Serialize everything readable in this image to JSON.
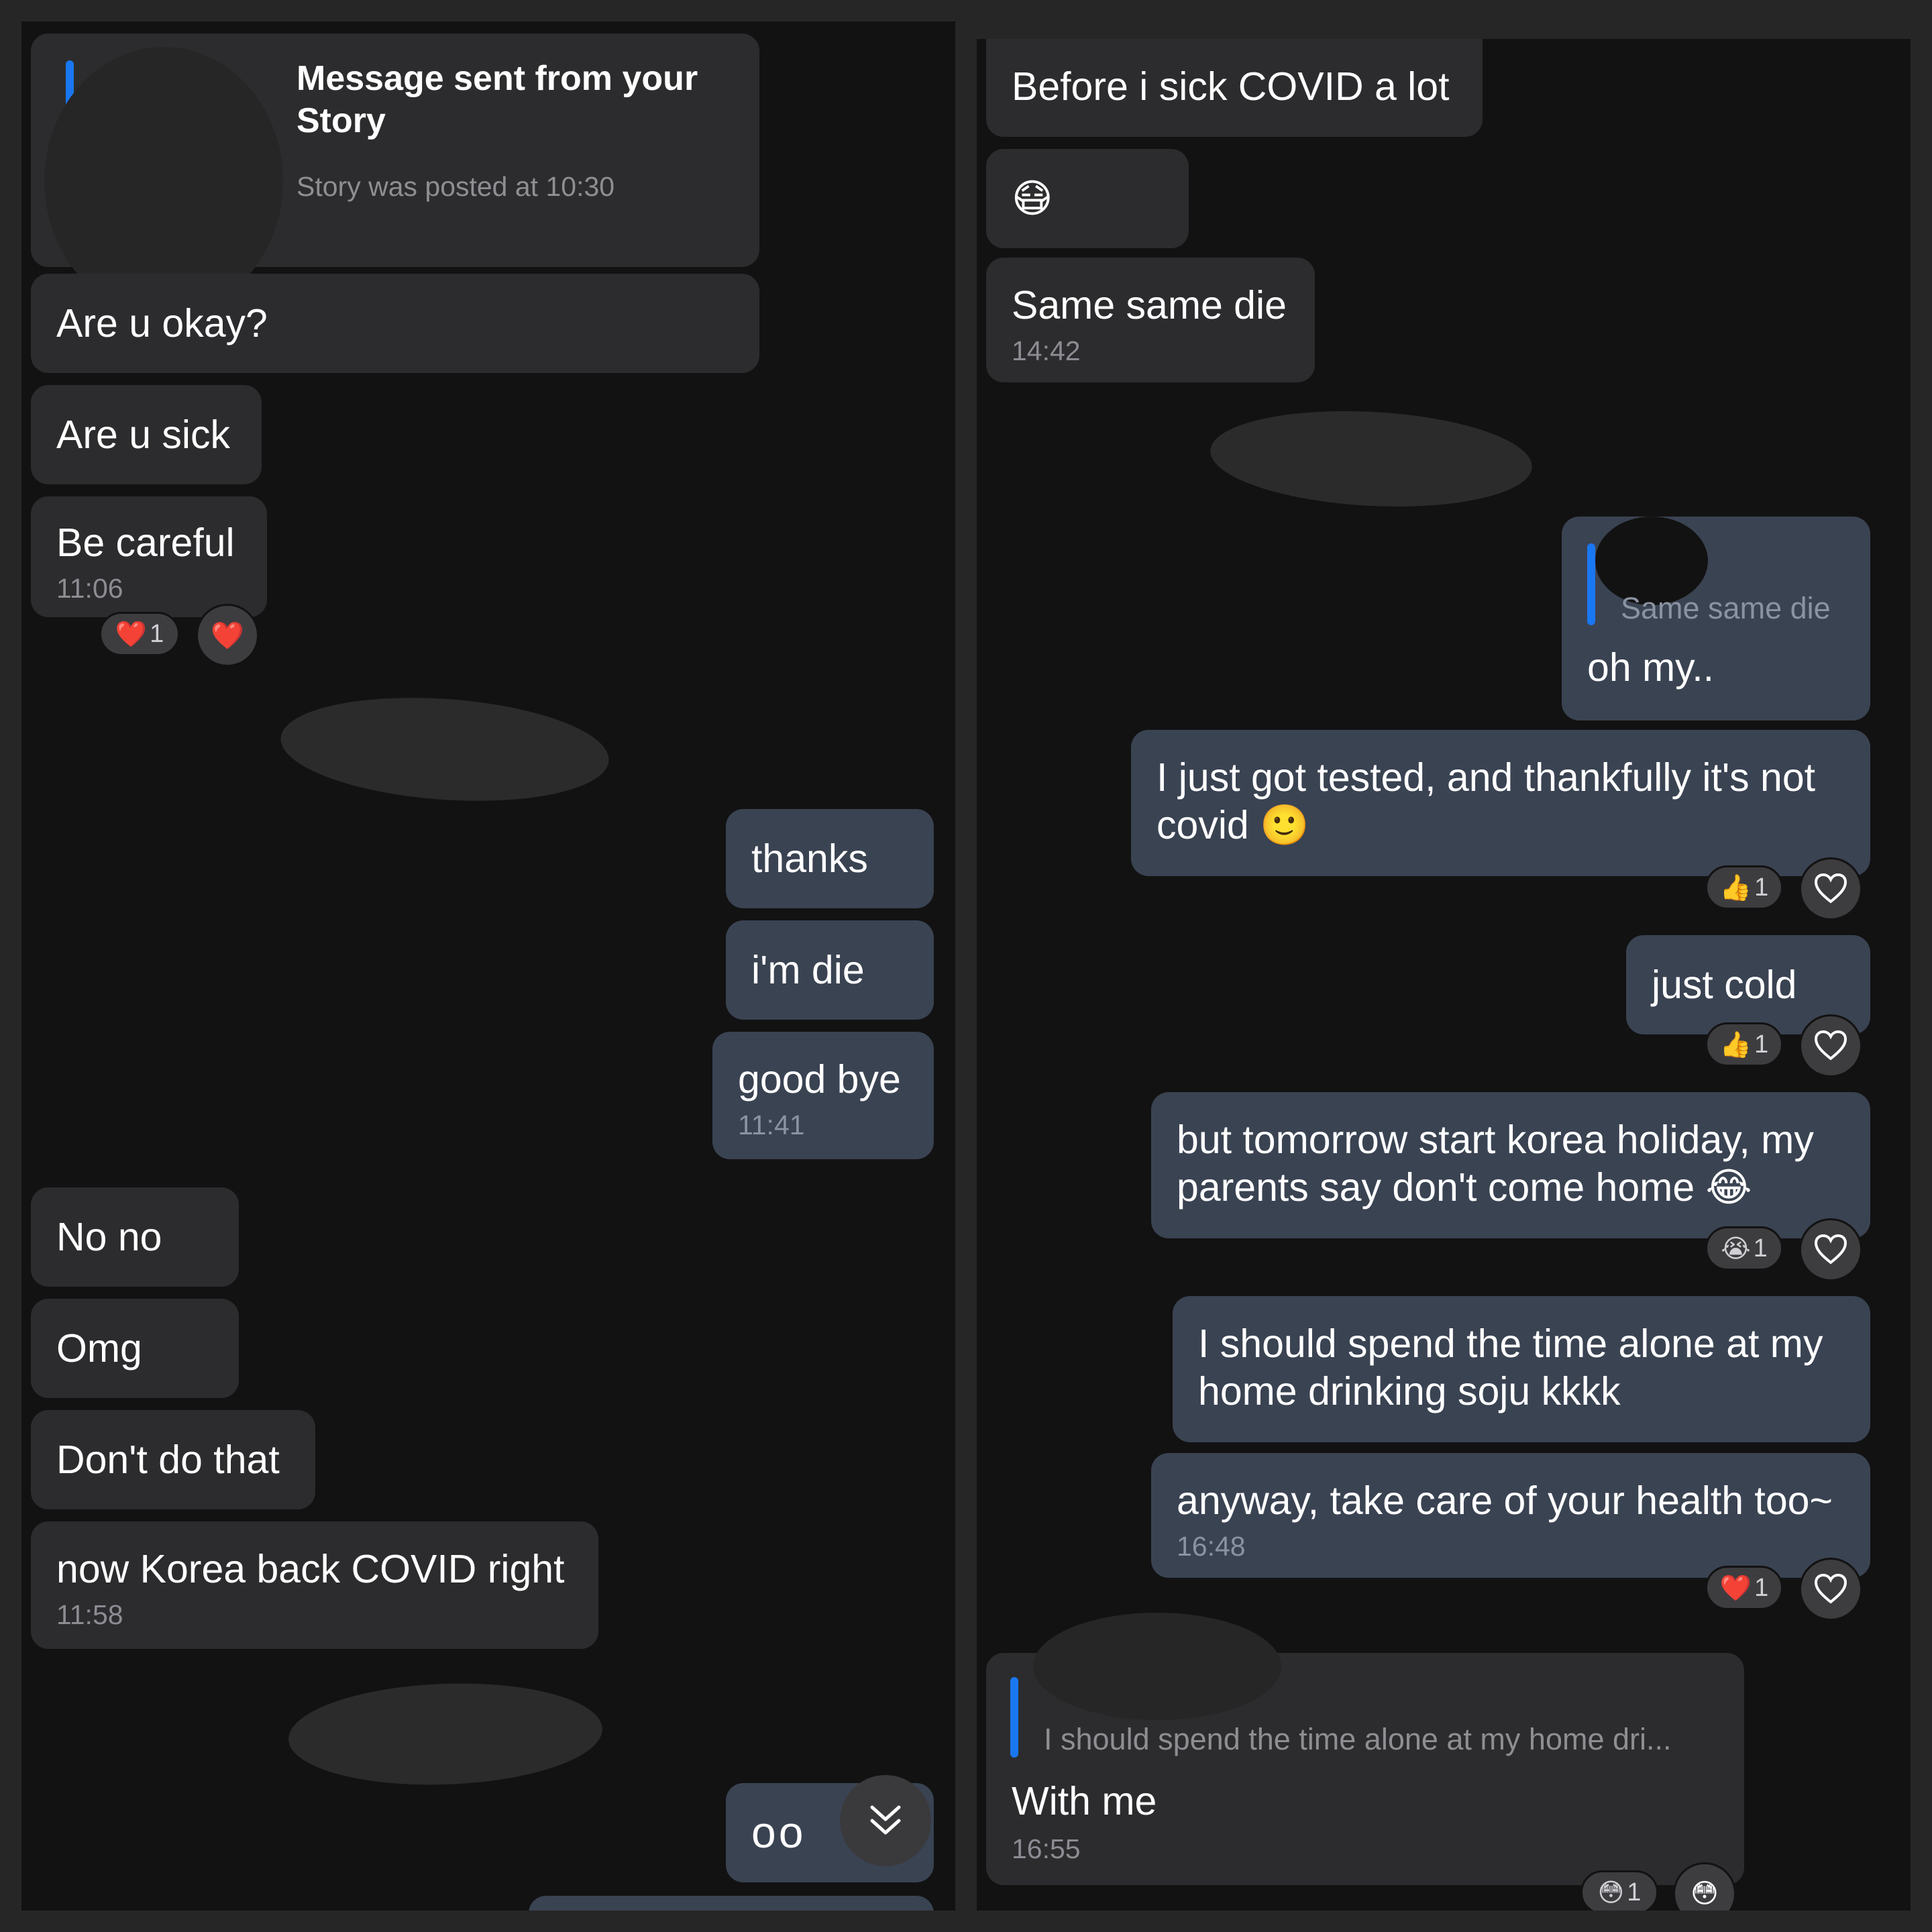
{
  "left": {
    "story_reply": {
      "title": "Message sent from your Story",
      "subtitle": "Story was posted at 10:30"
    },
    "messages": [
      {
        "text": "Are u okay?"
      },
      {
        "text": "Are u sick"
      },
      {
        "text": "Be careful",
        "time": "11:06"
      },
      {
        "text": "thanks"
      },
      {
        "text": "i'm die"
      },
      {
        "text": "good bye",
        "time": "11:41"
      },
      {
        "text": "No no"
      },
      {
        "text": "Omg"
      },
      {
        "text": "Don't do that"
      },
      {
        "text": "now Korea back COVID right",
        "time": "11:58"
      },
      {
        "text": "oo"
      }
    ],
    "reactions": {
      "heart_count": "1"
    }
  },
  "right": {
    "messages": [
      {
        "text": "Before i sick COVID a lot"
      },
      {
        "text": "😷"
      },
      {
        "text": "Same same die",
        "time": "14:42"
      },
      {
        "quote": "Same same die",
        "text": "oh my.."
      },
      {
        "text": "I just got tested, and thankfully it's not covid 🙂"
      },
      {
        "text": "just cold"
      },
      {
        "text": "but tomorrow start korea holiday, my parents say don't come home 😂"
      },
      {
        "text": "I should spend the time alone at my home drinking soju kkkk"
      },
      {
        "text": "anyway, take care of your health too~",
        "time": "16:48"
      },
      {
        "quote": "I should spend the time alone at my home dri...",
        "text": "With me",
        "time": "16:55"
      }
    ],
    "reactions": {
      "thumbs_1": "1",
      "thumbs_2": "1",
      "cry": "1",
      "heart": "1",
      "flushed": "1"
    }
  },
  "icons": {
    "heart": "❤️",
    "thumbs": "👍",
    "cry": "😭",
    "flushed": "😳",
    "scroll_down": "chevron-double-down"
  }
}
